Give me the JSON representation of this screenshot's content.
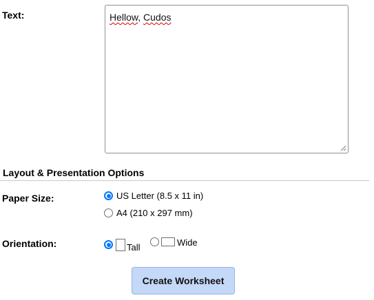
{
  "text_field": {
    "label": "Text:",
    "value_word1": "Hellow",
    "value_separator": ", ",
    "value_word2": "Cudos"
  },
  "layout_section": {
    "title": "Layout & Presentation Options"
  },
  "paper_size": {
    "label": "Paper Size:",
    "selected": "US Letter (8.5 x 11 in)",
    "options": [
      {
        "label": "US Letter (8.5 x 11 in)",
        "checked": true
      },
      {
        "label": "A4 (210 x 297 mm)",
        "checked": false
      }
    ]
  },
  "orientation": {
    "label": "Orientation:",
    "selected": "Tall",
    "options": [
      {
        "label": "Tall",
        "icon": "portrait-page-icon",
        "checked": true
      },
      {
        "label": "Wide",
        "icon": "landscape-page-icon",
        "checked": false
      }
    ]
  },
  "actions": {
    "create_label": "Create Worksheet"
  },
  "colors": {
    "radio_accent": "#0075ff",
    "button_bg": "#c4d8f7",
    "spellcheck_underline": "#d40000"
  }
}
